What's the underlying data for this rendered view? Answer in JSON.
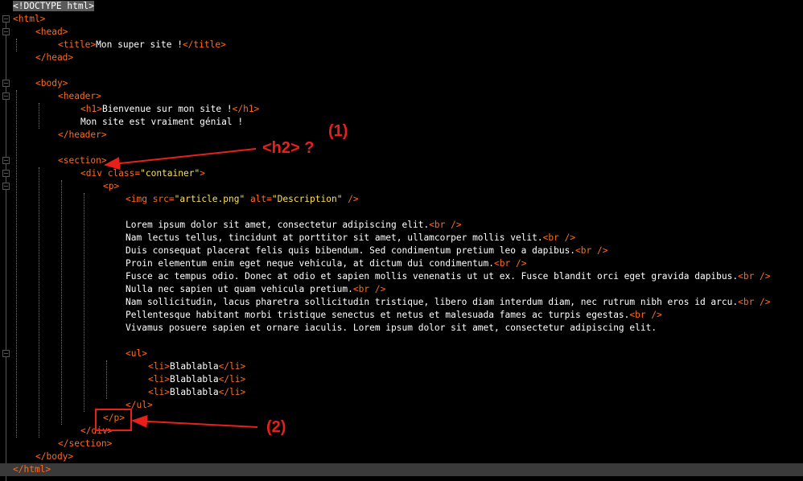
{
  "lines": [
    [
      {
        "t": "<!DOCTYPE html>",
        "c": "doc"
      }
    ],
    [
      {
        "t": "<html>",
        "c": "tag"
      }
    ],
    [
      {
        "t": "<head>",
        "c": "tag"
      }
    ],
    [
      {
        "t": "<title>",
        "c": "tag"
      },
      {
        "t": "Mon super site !",
        "c": "text"
      },
      {
        "t": "</title>",
        "c": "tag"
      }
    ],
    [
      {
        "t": "</head>",
        "c": "tag"
      }
    ],
    [],
    [
      {
        "t": "<body>",
        "c": "tag"
      }
    ],
    [
      {
        "t": "<header>",
        "c": "tag"
      }
    ],
    [
      {
        "t": "<h1>",
        "c": "tag"
      },
      {
        "t": "Bienvenue sur mon site !",
        "c": "text"
      },
      {
        "t": "</h1>",
        "c": "tag"
      }
    ],
    [
      {
        "t": "Mon site est vraiment génial !",
        "c": "text"
      }
    ],
    [
      {
        "t": "</header>",
        "c": "tag"
      }
    ],
    [],
    [
      {
        "t": "<section>",
        "c": "tag"
      }
    ],
    [
      {
        "t": "<div ",
        "c": "tag"
      },
      {
        "t": "class=",
        "c": "attr"
      },
      {
        "t": "\"container\"",
        "c": "val"
      },
      {
        "t": ">",
        "c": "tag"
      }
    ],
    [
      {
        "t": "<p>",
        "c": "tag"
      }
    ],
    [
      {
        "t": "<img ",
        "c": "tag"
      },
      {
        "t": "src=",
        "c": "attr"
      },
      {
        "t": "\"article.png\"",
        "c": "val"
      },
      {
        "t": " alt=",
        "c": "attr"
      },
      {
        "t": "\"Description\"",
        "c": "val"
      },
      {
        "t": " />",
        "c": "tag"
      }
    ],
    [],
    [
      {
        "t": "Lorem ipsum dolor sit amet, consectetur adipiscing elit.",
        "c": "text"
      },
      {
        "t": "<br />",
        "c": "tag"
      }
    ],
    [
      {
        "t": "Nam lectus tellus, tincidunt at porttitor sit amet, ullamcorper mollis velit.",
        "c": "text"
      },
      {
        "t": "<br />",
        "c": "tag"
      }
    ],
    [
      {
        "t": "Duis consequat placerat felis quis bibendum. Sed condimentum pretium leo a dapibus.",
        "c": "text"
      },
      {
        "t": "<br />",
        "c": "tag"
      }
    ],
    [
      {
        "t": "Proin elementum enim eget neque vehicula, at dictum dui condimentum.",
        "c": "text"
      },
      {
        "t": "<br />",
        "c": "tag"
      }
    ],
    [
      {
        "t": "Fusce ac tempus odio. Donec at odio et sapien mollis venenatis ut ut ex. Fusce blandit orci eget gravida dapibus.",
        "c": "text"
      },
      {
        "t": "<br />",
        "c": "tag"
      }
    ],
    [
      {
        "t": "Nulla nec sapien ut quam vehicula pretium.",
        "c": "text"
      },
      {
        "t": "<br />",
        "c": "tag"
      }
    ],
    [
      {
        "t": "Nam sollicitudin, lacus pharetra sollicitudin tristique, libero diam interdum diam, nec rutrum nibh eros id arcu.",
        "c": "text"
      },
      {
        "t": "<br />",
        "c": "tag"
      }
    ],
    [
      {
        "t": "Pellentesque habitant morbi tristique senectus et netus et malesuada fames ac turpis egestas.",
        "c": "text"
      },
      {
        "t": "<br />",
        "c": "tag"
      }
    ],
    [
      {
        "t": "Vivamus posuere sapien et ornare iaculis. Lorem ipsum dolor sit amet, consectetur adipiscing elit.",
        "c": "text"
      }
    ],
    [],
    [
      {
        "t": "<ul>",
        "c": "tag"
      }
    ],
    [
      {
        "t": "<li>",
        "c": "tag"
      },
      {
        "t": "Blablabla",
        "c": "text"
      },
      {
        "t": "</li>",
        "c": "tag"
      }
    ],
    [
      {
        "t": "<li>",
        "c": "tag"
      },
      {
        "t": "Blablabla",
        "c": "text"
      },
      {
        "t": "</li>",
        "c": "tag"
      }
    ],
    [
      {
        "t": "<li>",
        "c": "tag"
      },
      {
        "t": "Blablabla",
        "c": "text"
      },
      {
        "t": "</li>",
        "c": "tag"
      }
    ],
    [
      {
        "t": "</ul>",
        "c": "tag"
      }
    ],
    [
      {
        "t": "</p>",
        "c": "tag"
      }
    ],
    [
      {
        "t": "</div>",
        "c": "tag"
      }
    ],
    [
      {
        "t": "</section>",
        "c": "tag"
      }
    ],
    [
      {
        "t": "</body>",
        "c": "tag"
      }
    ],
    [
      {
        "t": "</html>",
        "c": "tag"
      }
    ]
  ],
  "annotations": {
    "h2_question": "<h2> ?",
    "label_1": "(1)",
    "label_2": "(2)"
  },
  "colors": {
    "background": "#000000",
    "tag": "#ff6a1f",
    "attribute_value": "#ffe14d",
    "text": "#ffffff",
    "annotation": "#e8201c"
  }
}
